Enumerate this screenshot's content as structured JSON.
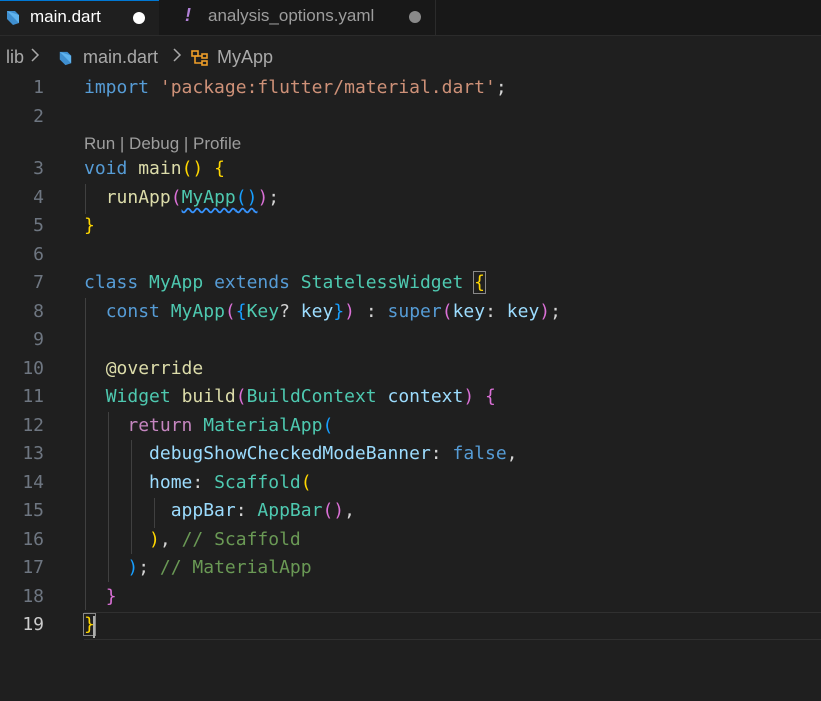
{
  "tabs": [
    {
      "label": "main.dart",
      "icon": "dart-icon",
      "state": "modified",
      "active": true
    },
    {
      "label": "analysis_options.yaml",
      "icon": "yaml-exclamation-icon",
      "state": "modified",
      "active": false
    }
  ],
  "breadcrumb": {
    "folder": "lib",
    "file": "main.dart",
    "symbol": "MyApp"
  },
  "codelens": "Run | Debug | Profile",
  "line_numbers": [
    "1",
    "2",
    "3",
    "4",
    "5",
    "6",
    "7",
    "8",
    "9",
    "10",
    "11",
    "12",
    "13",
    "14",
    "15",
    "16",
    "17",
    "18",
    "19"
  ],
  "current_line": "19",
  "code": {
    "l1": {
      "kw": "import",
      "str": "'package:flutter/material.dart'",
      "end": ";"
    },
    "l3": {
      "kw": "void",
      "fn": "main",
      "open": "()",
      "brace": "{"
    },
    "l4": {
      "fn": "runApp",
      "p": "(",
      "cls": "MyApp",
      "inner": "()",
      "pc": ")",
      "end": ";"
    },
    "l5": {
      "brace": "}"
    },
    "l7": {
      "kw1": "class",
      "cls1": "MyApp",
      "kw2": "extends",
      "cls2": "StatelessWidget",
      "brace": "{"
    },
    "l8": {
      "kw": "const",
      "cls": "MyApp",
      "p": "(",
      "b": "{",
      "type": "Key",
      "q": "?",
      "var": "key",
      "bc": "}",
      "pc": ")",
      "colon": ":",
      "sup": "super",
      "p2": "(",
      "arg": "key",
      "c2": ":",
      "val": "key",
      "p2c": ")",
      "end": ";"
    },
    "l10": {
      "ann": "@override"
    },
    "l11": {
      "cls1": "Widget",
      "fn": "build",
      "p": "(",
      "cls2": "BuildContext",
      "var": "context",
      "pc": ")",
      "brace": "{"
    },
    "l12": {
      "ctl": "return",
      "cls": "MaterialApp",
      "p": "("
    },
    "l13": {
      "var": "debugShowCheckedModeBanner",
      "colon": ":",
      "kw": "false",
      "end": ","
    },
    "l14": {
      "var": "home",
      "colon": ":",
      "cls": "Scaffold",
      "p": "("
    },
    "l15": {
      "var": "appBar",
      "colon": ":",
      "cls": "AppBar",
      "p": "()",
      "end": ","
    },
    "l16": {
      "pc": ")",
      "end": ",",
      "cmt": "// Scaffold"
    },
    "l17": {
      "pc": ")",
      "end": ";",
      "cmt": "// MaterialApp"
    },
    "l18": {
      "brace": "}"
    },
    "l19": {
      "brace": "}"
    }
  }
}
